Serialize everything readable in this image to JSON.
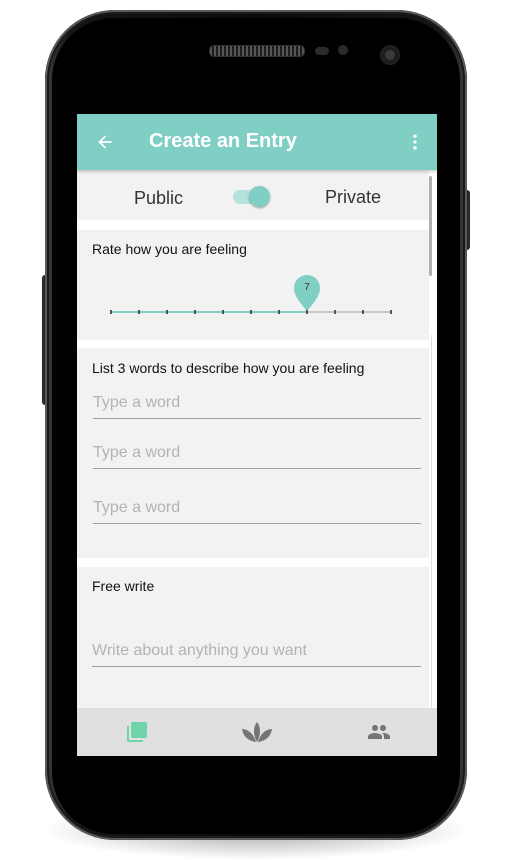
{
  "appbar": {
    "title": "Create an Entry",
    "back_icon": "arrow-back-icon",
    "menu_icon": "more-vert-icon"
  },
  "visibility": {
    "public_label": "Public",
    "private_label": "Private",
    "toggle_state": "private"
  },
  "rating": {
    "label": "Rate how you are feeling",
    "value": "7",
    "min": 0,
    "max": 10
  },
  "words": {
    "label": "List 3 words to describe how you are feeling",
    "placeholders": [
      "Type a word",
      "Type a word",
      "Type a word"
    ]
  },
  "free_write": {
    "label": "Free write",
    "placeholder": "Write about anything you want"
  },
  "bottom_nav": [
    {
      "icon": "entries-icon",
      "active": true
    },
    {
      "icon": "lotus-icon",
      "active": false
    },
    {
      "icon": "people-icon",
      "active": false
    }
  ],
  "colors": {
    "accent": "#7fcfc4",
    "card_background": "#f2f2f2",
    "nav_background": "#e0e0e0",
    "icon_active": "#6fd4a8",
    "icon_inactive": "#757575"
  }
}
